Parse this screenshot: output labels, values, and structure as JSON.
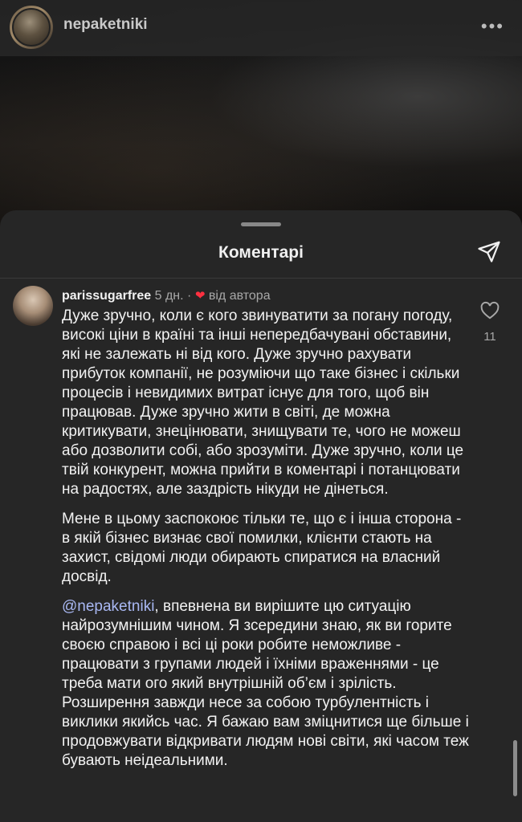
{
  "story": {
    "username": "nepaketniki",
    "more_label": "•••"
  },
  "sheet": {
    "title": "Коментарі"
  },
  "comment": {
    "username": "parissugarfree",
    "time": "5 дн.",
    "separator": "·",
    "author_badge": "від автора",
    "likes": "11",
    "paragraph1": "Дуже зручно, коли є кого звинуватити за погану погоду, високі ціни в країні та інші непередбачувані обставини, які не залежать ні від кого. Дуже зручно рахувати прибуток компанії, не розуміючи що таке бізнес і скільки процесів і невидимих витрат існує для того, щоб він працював. Дуже зручно жити в світі, де можна критикувати, знецінювати, знищувати те, чого не можеш або дозволити собі, або зрозуміти. Дуже зручно, коли це твій конкурент, можна прийти в коментарі і потанцювати на радостях, але заздрість нікуди не дінеться.",
    "paragraph2": "Мене в цьому заспокоює тільки те, що є і інша сторона - в якій бізнес визнає свої помилки, клієнти стають на захист, свідомі люди обирають спиратися на власний досвід.",
    "mention": "@nepaketniki",
    "paragraph3": ", впевнена ви вирішите цю ситуацію найрозумнішим чином. Я зсередини знаю, як ви горите своєю справою і всі ці роки робите неможливе - працювати з групами людей і їхніми враженнями - це треба мати ого який внутрішній об’єм і зрілість. Розширення завжди несе за собою турбулентність і виклики якийсь час. Я бажаю вам зміцнитися ще більше і продовжувати відкривати людям нові світи, які часом теж бувають неідеальними."
  },
  "colors": {
    "sheet_bg": "#262626",
    "heart": "#ff3040",
    "mention": "#a9b8f3"
  },
  "icons": [
    "more-icon",
    "share-send-icon",
    "heart-icon",
    "like-heart-icon"
  ]
}
